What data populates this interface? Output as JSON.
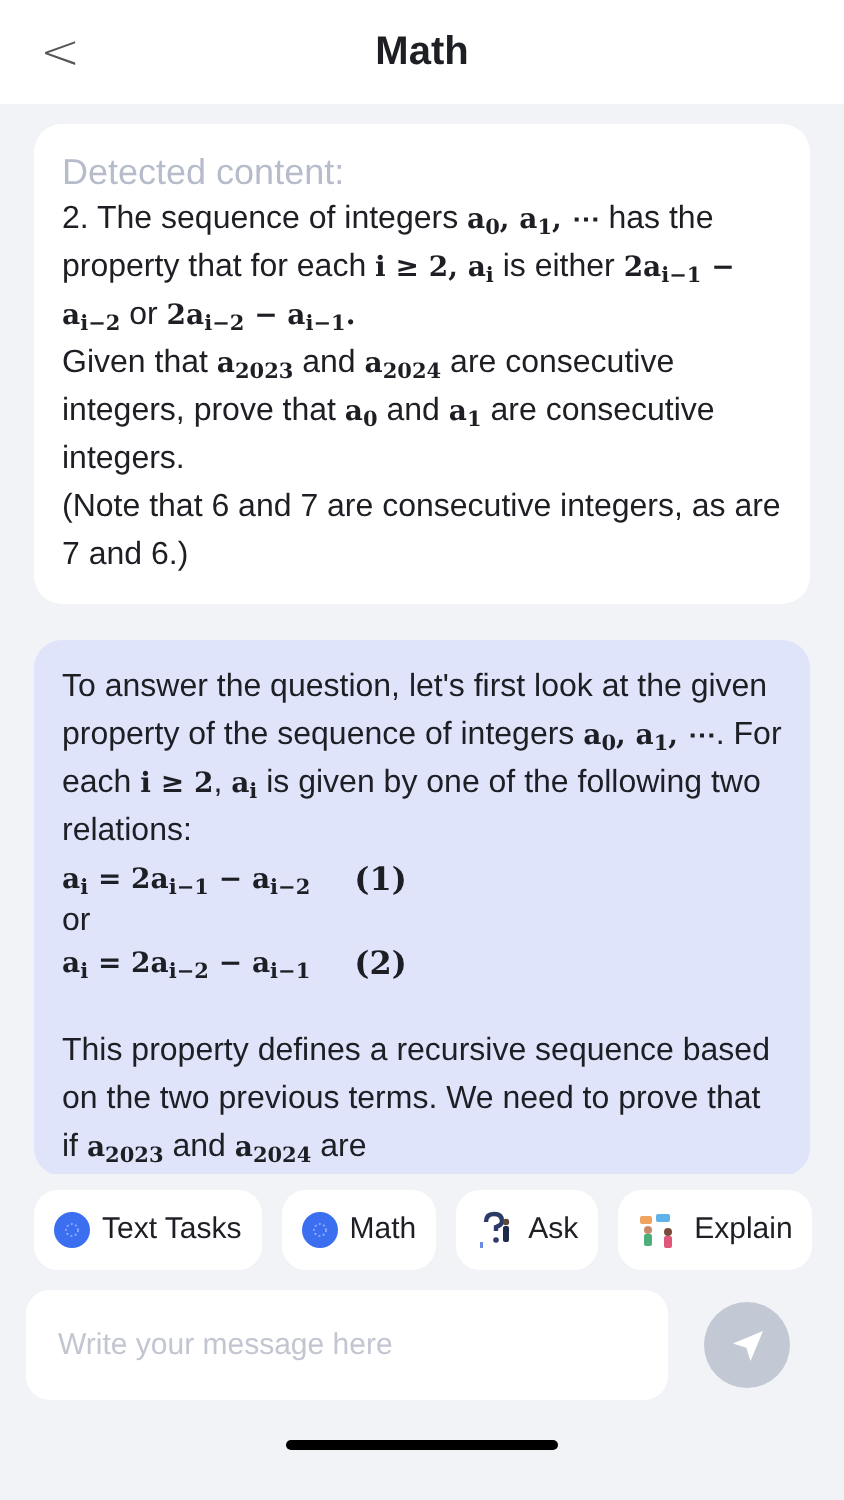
{
  "header": {
    "back": "<",
    "title": "Math"
  },
  "detected": {
    "label": "Detected content:",
    "paragraphs": [
      [
        {
          "kind": "text",
          "text": "2. The sequence of integers "
        },
        {
          "kind": "math",
          "text": "a$_{0}$, a$_{1}$, ⋯"
        },
        {
          "kind": "text",
          "text": " has the property that for each "
        },
        {
          "kind": "math",
          "text": "i ≥ 2, a$_{i}$"
        },
        {
          "kind": "text",
          "text": " is either "
        },
        {
          "kind": "math",
          "text": "2a$_{i−1}$ − a$_{i−2}$"
        },
        {
          "kind": "text",
          "text": " or "
        },
        {
          "kind": "math",
          "text": "2a$_{i−2}$ − a$_{i−1}$."
        }
      ],
      [
        {
          "kind": "text",
          "text": "Given that "
        },
        {
          "kind": "math",
          "text": "a$_{2023}$"
        },
        {
          "kind": "text",
          "text": " and "
        },
        {
          "kind": "math",
          "text": "a$_{2024}$"
        },
        {
          "kind": "text",
          "text": " are consecutive integers, prove that "
        },
        {
          "kind": "math",
          "text": "a$_{0}$"
        },
        {
          "kind": "text",
          "text": " and "
        },
        {
          "kind": "math",
          "text": "a$_{1}$"
        },
        {
          "kind": "text",
          "text": " are consecutive integers."
        }
      ],
      [
        {
          "kind": "text",
          "text": "(Note that 6 and 7 are consecutive integers, as are 7 and 6.)"
        }
      ]
    ]
  },
  "answer": {
    "blocks": [
      {
        "kind": "paragraph",
        "segments": [
          {
            "kind": "text",
            "text": "To answer the question, let's first look at the given property of the sequence of integers "
          },
          {
            "kind": "math",
            "text": "a$_{0}$, a$_{1}$, ⋯"
          },
          {
            "kind": "text",
            "text": ". For each "
          },
          {
            "kind": "math",
            "text": "i ≥ 2"
          },
          {
            "kind": "text",
            "text": ", "
          },
          {
            "kind": "math",
            "text": "a$_{i}$"
          },
          {
            "kind": "text",
            "text": " is given by one of the following two relations:"
          }
        ]
      },
      {
        "kind": "equation",
        "math": "a$_{i}$ = 2a$_{i−1}$ − a$_{i−2}$",
        "tag": "(1)"
      },
      {
        "kind": "line",
        "text": "or"
      },
      {
        "kind": "equation",
        "math": "a$_{i}$ = 2a$_{i−2}$ − a$_{i−1}$",
        "tag": "(2)"
      },
      {
        "kind": "paragraph",
        "segments": [
          {
            "kind": "text",
            "text": "This property defines a recursive sequence based on the two previous terms. We need to prove that if "
          },
          {
            "kind": "math",
            "text": "a$_{2023}$"
          },
          {
            "kind": "text",
            "text": " and "
          },
          {
            "kind": "math",
            "text": "a$_{2024}$"
          },
          {
            "kind": "text",
            "text": " are"
          }
        ]
      }
    ]
  },
  "chips": [
    {
      "kind": "dot",
      "label": "Text Tasks"
    },
    {
      "kind": "dot",
      "label": "Math"
    },
    {
      "kind": "ask",
      "label": "Ask"
    },
    {
      "kind": "explain",
      "label": "Explain"
    }
  ],
  "composer": {
    "placeholder": "Write your message here"
  }
}
